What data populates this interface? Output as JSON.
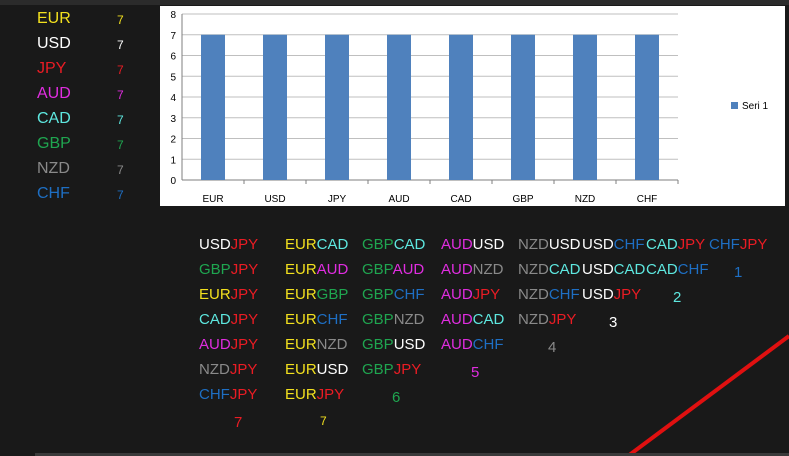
{
  "colors": {
    "EUR": "#f2e01e",
    "USD": "#ffffff",
    "JPY": "#ea1c24",
    "AUD": "#e02de0",
    "CAD": "#5ee8e0",
    "GBP": "#1fa650",
    "NZD": "#8a8a8a",
    "CHF": "#1e6fc4",
    "bar": "#4f81bd",
    "red_line": "#e01010"
  },
  "currencies": [
    {
      "name": "EUR",
      "value": "7"
    },
    {
      "name": "USD",
      "value": "7"
    },
    {
      "name": "JPY",
      "value": "7"
    },
    {
      "name": "AUD",
      "value": "7"
    },
    {
      "name": "CAD",
      "value": "7"
    },
    {
      "name": "GBP",
      "value": "7"
    },
    {
      "name": "NZD",
      "value": "7"
    },
    {
      "name": "CHF",
      "value": "7"
    }
  ],
  "chart_data": {
    "type": "bar",
    "categories": [
      "EUR",
      "USD",
      "JPY",
      "AUD",
      "CAD",
      "GBP",
      "NZD",
      "CHF"
    ],
    "series": [
      {
        "name": "Seri 1",
        "values": [
          7,
          7,
          7,
          7,
          7,
          7,
          7,
          7
        ]
      }
    ],
    "ylim": [
      0,
      8
    ],
    "yticks": [
      0,
      1,
      2,
      3,
      4,
      5,
      6,
      7,
      8
    ],
    "grid": true,
    "legend_position": "right",
    "title": "",
    "xlabel": "",
    "ylabel": ""
  },
  "pair_columns": [
    {
      "key": "JPY",
      "pairs": [
        {
          "base": "USD",
          "quote": "JPY",
          "text": "USDJPY"
        },
        {
          "base": "GBP",
          "quote": "JPY",
          "text": "GBPJPY"
        },
        {
          "base": "EUR",
          "quote": "JPY",
          "text": "EURJPY"
        },
        {
          "base": "CAD",
          "quote": "JPY",
          "text": "CADJPY"
        },
        {
          "base": "AUD",
          "quote": "JPY",
          "text": "AUDJPY"
        },
        {
          "base": "NZD",
          "quote": "JPY",
          "text": "NZDJPY"
        },
        {
          "base": "CHF",
          "quote": "JPY",
          "text": "CHFJPY"
        }
      ],
      "count": "7"
    },
    {
      "key": "EUR",
      "pairs": [
        {
          "base": "EUR",
          "quote": "CAD",
          "text": "EURCAD"
        },
        {
          "base": "EUR",
          "quote": "AUD",
          "text": "EURAUD"
        },
        {
          "base": "EUR",
          "quote": "GBP",
          "text": "EURGBP"
        },
        {
          "base": "EUR",
          "quote": "CHF",
          "text": "EURCHF"
        },
        {
          "base": "EUR",
          "quote": "NZD",
          "text": "EURNZD"
        },
        {
          "base": "EUR",
          "quote": "USD",
          "text": "EURUSD"
        },
        {
          "base": "EUR",
          "quote": "JPY",
          "text": "EURJPY"
        }
      ],
      "count": "7"
    },
    {
      "key": "GBP",
      "pairs": [
        {
          "base": "GBP",
          "quote": "CAD",
          "text": "GBPCAD"
        },
        {
          "base": "GBP",
          "quote": "AUD",
          "text": "GBPAUD"
        },
        {
          "base": "GBP",
          "quote": "CHF",
          "text": "GBPCHF"
        },
        {
          "base": "GBP",
          "quote": "NZD",
          "text": "GBPNZD"
        },
        {
          "base": "GBP",
          "quote": "USD",
          "text": "GBPUSD"
        },
        {
          "base": "GBP",
          "quote": "JPY",
          "text": "GBPJPY"
        }
      ],
      "count": "6"
    },
    {
      "key": "AUD",
      "pairs": [
        {
          "base": "AUD",
          "quote": "USD",
          "text": "AUDUSD"
        },
        {
          "base": "AUD",
          "quote": "NZD",
          "text": "AUDNZD"
        },
        {
          "base": "AUD",
          "quote": "JPY",
          "text": "AUDJPY"
        },
        {
          "base": "AUD",
          "quote": "CAD",
          "text": "AUDCAD"
        },
        {
          "base": "AUD",
          "quote": "CHF",
          "text": "AUDCHF"
        }
      ],
      "count": "5"
    },
    {
      "key": "NZD",
      "pairs": [
        {
          "base": "NZD",
          "quote": "USD",
          "text": "NZDUSD"
        },
        {
          "base": "NZD",
          "quote": "CAD",
          "text": "NZDCAD"
        },
        {
          "base": "NZD",
          "quote": "CHF",
          "text": "NZDCHF"
        },
        {
          "base": "NZD",
          "quote": "JPY",
          "text": "NZDJPY"
        }
      ],
      "count": "4"
    },
    {
      "key": "USD",
      "pairs": [
        {
          "base": "USD",
          "quote": "CHF",
          "text": "USDCHF"
        },
        {
          "base": "USD",
          "quote": "CAD",
          "text": "USDCAD"
        },
        {
          "base": "USD",
          "quote": "JPY",
          "text": "USDJPY"
        }
      ],
      "count": "3"
    },
    {
      "key": "CAD",
      "pairs": [
        {
          "base": "CAD",
          "quote": "JPY",
          "text": "CADJPY"
        },
        {
          "base": "CAD",
          "quote": "CHF",
          "text": "CADCHF"
        }
      ],
      "count": "2"
    },
    {
      "key": "CHF",
      "pairs": [
        {
          "base": "CHF",
          "quote": "JPY",
          "text": "CHFJPY"
        }
      ],
      "count": "1"
    }
  ]
}
